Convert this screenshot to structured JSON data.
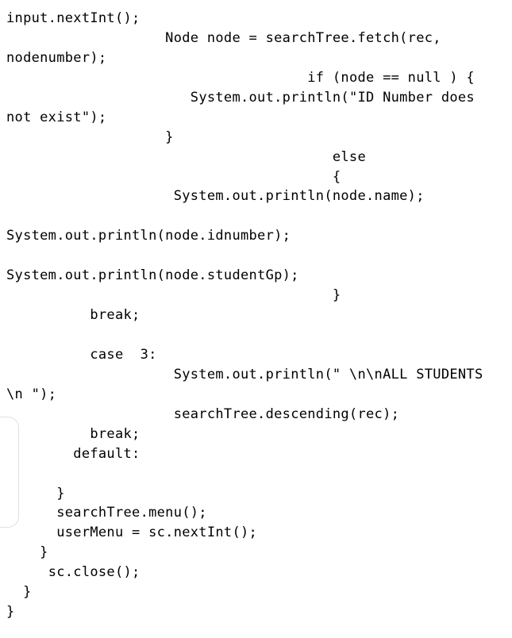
{
  "code": {
    "lines": [
      "input.nextInt();",
      "                   Node node = searchTree.fetch(rec, nodenumber);",
      "                                    if (node == null ) {",
      "                      System.out.println(\"ID Number does not exist\");",
      "                   }",
      "                                       else",
      "                                       {",
      "                    System.out.println(node.name);",
      "",
      "System.out.println(node.idnumber);",
      "",
      "System.out.println(node.studentGp);",
      "                                       }",
      "          break;",
      "",
      "          case  3:",
      "                    System.out.println(\" \\n\\nALL STUDENTS \\n \");",
      "                    searchTree.descending(rec);",
      "          break;",
      "        default:",
      "",
      "      }",
      "      searchTree.menu();",
      "      userMenu = sc.nextInt();",
      "    }",
      "     sc.close();",
      "  }",
      "}"
    ]
  }
}
